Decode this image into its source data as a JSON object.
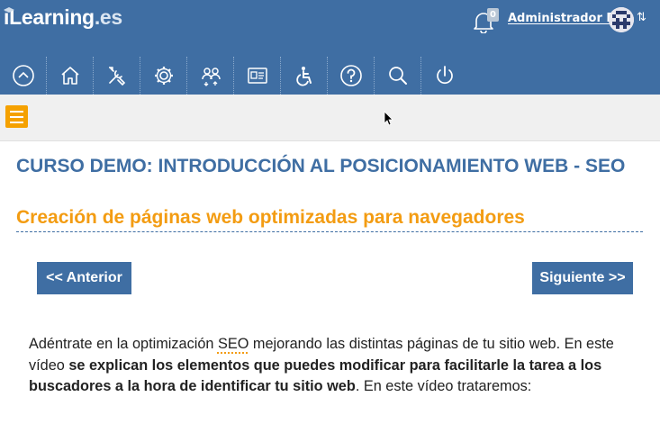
{
  "header": {
    "logo_main": "iLearning",
    "logo_suffix": ".es",
    "notifications_count": "0",
    "username": "Administrador Pl...",
    "switch_glyph": "⇅"
  },
  "nav": {
    "items": [
      {
        "name": "collapse",
        "icon": "chevron-up-circle-icon"
      },
      {
        "name": "home",
        "icon": "home-icon"
      },
      {
        "name": "tools",
        "icon": "tools-icon"
      },
      {
        "name": "settings",
        "icon": "gear-icon"
      },
      {
        "name": "users",
        "icon": "users-icon"
      },
      {
        "name": "id-card",
        "icon": "id-card-icon"
      },
      {
        "name": "accessibility",
        "icon": "accessibility-icon"
      },
      {
        "name": "help",
        "icon": "help-icon"
      },
      {
        "name": "search",
        "icon": "search-icon"
      },
      {
        "name": "logout",
        "icon": "power-icon"
      }
    ]
  },
  "page": {
    "course_title": "CURSO DEMO: INTRODUCCIÓN AL POSICIONAMIENTO WEB - SEO",
    "lesson_title": "Creación de páginas web optimizadas para navegadores",
    "prev_label": "<< Anterior",
    "next_label": "Siguiente >>"
  },
  "content": {
    "p1_a": "Adéntrate en la optimización ",
    "p1_abbr": "SEO",
    "p1_b": " mejorando las distintas páginas de tu sitio web. En este vídeo ",
    "p1_bold": "se explican los elementos que puedes modificar para facilitarle la tarea a los buscadores a la hora de identificar tu sitio web",
    "p1_c": ". En este vídeo trataremos:"
  },
  "colors": {
    "brand_blue": "#3f6ea3",
    "accent_orange": "#f39c12",
    "toolbar_gray": "#f0f0f0"
  }
}
